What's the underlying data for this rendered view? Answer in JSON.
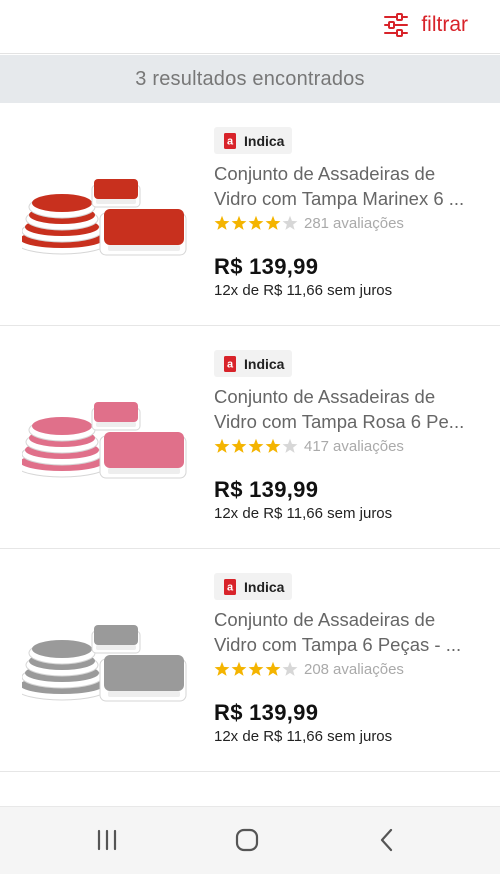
{
  "header": {
    "filter_label": "filtrar",
    "filter_icon": "sliders-icon",
    "accent_color": "#d8232a"
  },
  "results": {
    "count": 3,
    "text": "3 resultados encontrados"
  },
  "products": [
    {
      "badge": "Indica",
      "title_line1": "Conjunto de Assadeiras de",
      "title_line2": "Vidro com Tampa Marinex 6 ...",
      "rating": 4,
      "rating_max": 5,
      "reviews_count": "281",
      "reviews_label": "avaliações",
      "price": "R$ 139,99",
      "installments": "12x de R$ 11,66 sem juros",
      "lid_color": "#c8301e"
    },
    {
      "badge": "Indica",
      "title_line1": "Conjunto de Assadeiras de",
      "title_line2": "Vidro com Tampa Rosa 6 Pe...",
      "rating": 4,
      "rating_max": 5,
      "reviews_count": "417",
      "reviews_label": "avaliações",
      "price": "R$ 139,99",
      "installments": "12x de R$ 11,66 sem juros",
      "lid_color": "#e0708a"
    },
    {
      "badge": "Indica",
      "title_line1": "Conjunto de Assadeiras de",
      "title_line2": "Vidro com Tampa 6 Peças - ...",
      "rating": 4,
      "rating_max": 5,
      "reviews_count": "208",
      "reviews_label": "avaliações",
      "price": "R$ 139,99",
      "installments": "12x de R$ 11,66 sem juros",
      "lid_color": "#9a9a9a"
    }
  ],
  "colors": {
    "star_filled": "#f4b400",
    "star_empty": "#d7d7d7",
    "badge_logo": "#d8232a"
  },
  "navigation": {
    "recent_icon": "recent-apps-icon",
    "home_icon": "home-icon",
    "back_icon": "back-icon"
  }
}
